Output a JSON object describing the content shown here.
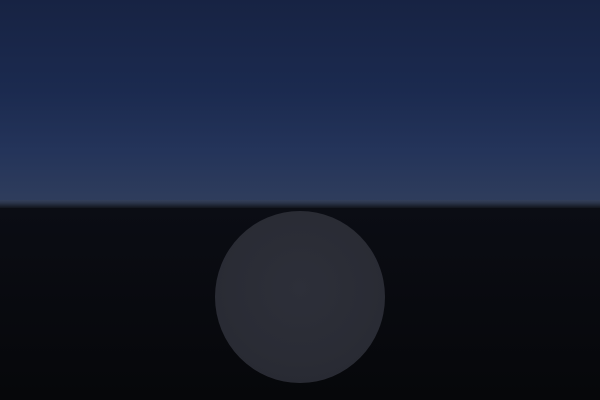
{
  "scene": {
    "colors": {
      "sky_top": "#172343",
      "sky_horizon": "#2f3d5c",
      "horizon_band": "#34405a",
      "ground": "#07080c",
      "sphere": "#2a2c35"
    },
    "objects": [
      "sky",
      "horizon-line",
      "ground-plane",
      "sphere"
    ]
  }
}
